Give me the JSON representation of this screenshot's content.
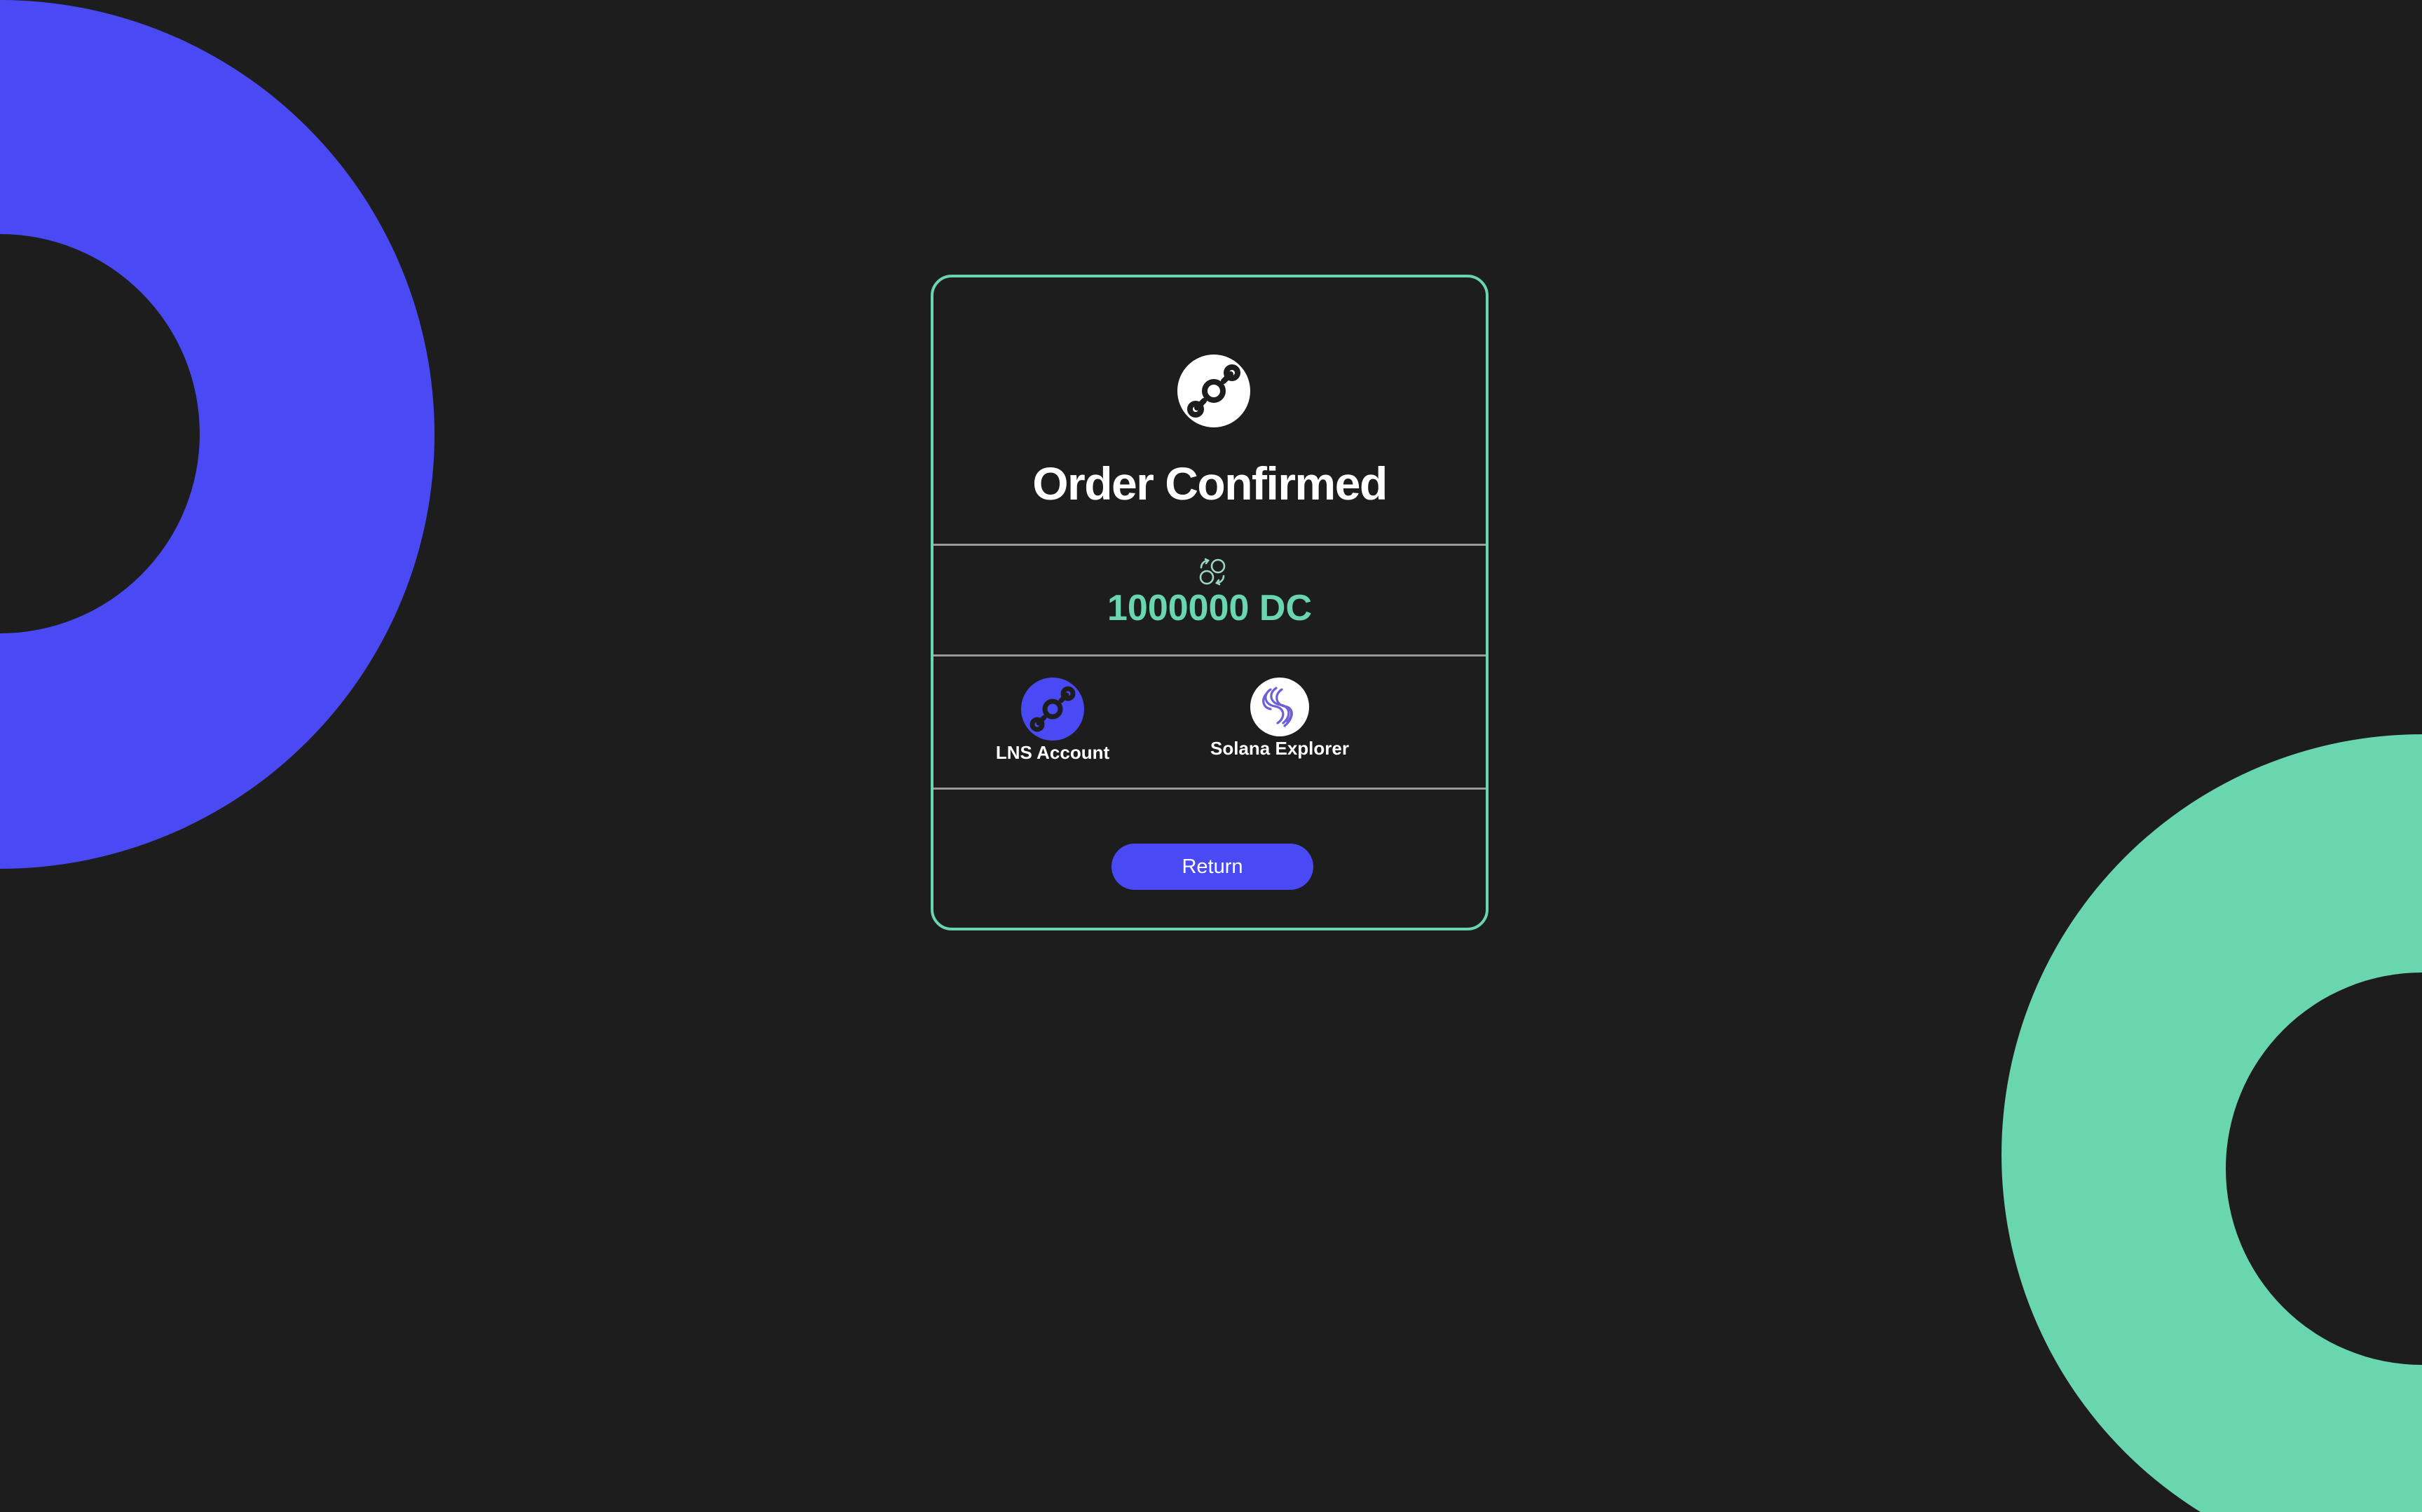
{
  "colors": {
    "background": "#1e1d1d",
    "accent_blue": "#4a4af4",
    "accent_green": "#6ad6b0",
    "text_primary": "#ffffff",
    "divider": "#9a9a9a"
  },
  "card": {
    "logo_icon": "helium-logo-icon",
    "title": "Order Confirmed"
  },
  "amount": {
    "icon": "swap-arrows-icon",
    "value": "1000000 DC"
  },
  "links": [
    {
      "icon": "helium-logo-icon",
      "label": "LNS Account"
    },
    {
      "icon": "solana-explorer-icon",
      "label": "Solana Explorer"
    }
  ],
  "actions": {
    "return_label": "Return"
  }
}
